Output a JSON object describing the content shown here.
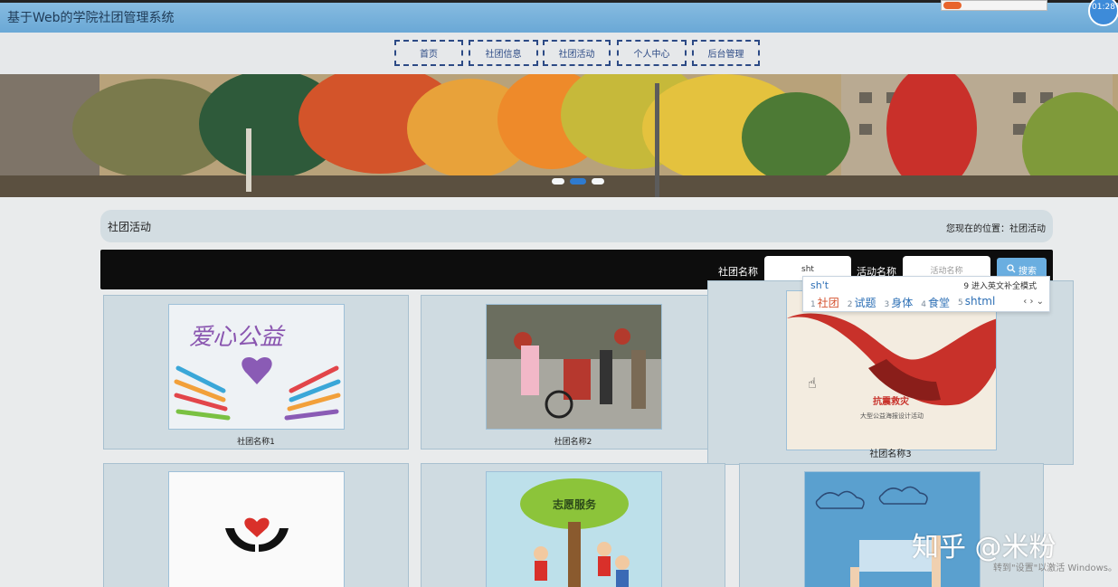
{
  "app": {
    "title": "基于Web的学院社团管理系统",
    "clock": "01:28"
  },
  "nav": {
    "items": [
      "首页",
      "社团信息",
      "社团活动",
      "个人中心",
      "后台管理"
    ]
  },
  "banner": {
    "slides": 3,
    "active_slide": 2
  },
  "breadcrumb": {
    "heading": "社团活动",
    "location": "您现在的位置：社团活动"
  },
  "search": {
    "club_label": "社团名称",
    "club_value": "sht",
    "activity_label": "活动名称",
    "activity_placeholder": "活动名称",
    "button_label": "搜索"
  },
  "ime": {
    "composition": "sh't",
    "hint": "9 进入英文补全模式",
    "candidates": [
      {
        "num": "1",
        "text": "社团"
      },
      {
        "num": "2",
        "text": "试题"
      },
      {
        "num": "3",
        "text": "身体"
      },
      {
        "num": "4",
        "text": "食堂"
      },
      {
        "num": "5",
        "text": "shtml"
      }
    ]
  },
  "cards": [
    {
      "name": "社团名称1",
      "image": "love-poster"
    },
    {
      "name": "社团名称2",
      "image": "street-photo"
    },
    {
      "name": "社团名称3",
      "image": "hands-poster"
    },
    {
      "name": "",
      "image": "heart-hands-icon"
    },
    {
      "name": "",
      "image": "volunteer-tree"
    },
    {
      "name": "",
      "image": "sky-hands"
    }
  ],
  "overlay": {
    "watermark": "知乎 @米粉",
    "windows_notice": "转到\"设置\"以激活 Windows。"
  },
  "colors": {
    "topbar": "#6aa8d6",
    "nav_border": "#2c4a85",
    "search_bg": "#0d0d0d",
    "search_button": "#6aaee0",
    "card_bg": "#cfdbe1"
  }
}
